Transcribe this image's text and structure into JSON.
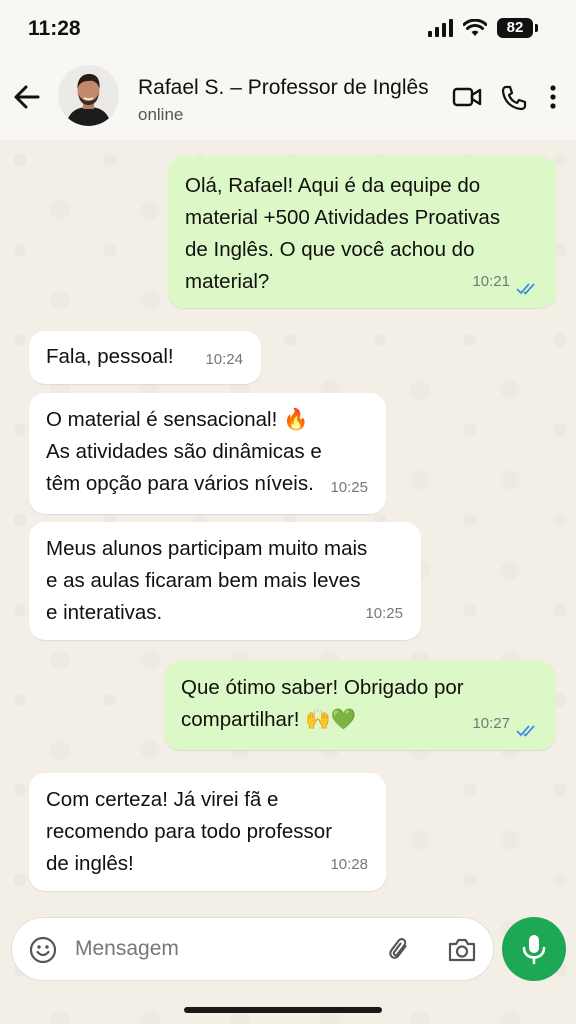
{
  "status_bar": {
    "time": "11:28",
    "battery": "82"
  },
  "header": {
    "contact_name": "Rafael S. – Professor de Inglês",
    "contact_status": "online"
  },
  "messages": [
    {
      "direction": "out",
      "text": "Olá, Rafael! Aqui é da equipe do\nmaterial +500 Atividades Proativas\nde Inglês. O que você achou do\nmaterial?",
      "time": "10:21",
      "read": true
    },
    {
      "direction": "in",
      "text": "Fala, pessoal!",
      "time": "10:24"
    },
    {
      "direction": "in",
      "text": "O material é sensacional! 🔥\nAs atividades são dinâmicas e\ntêm opção para vários níveis.",
      "time": "10:25"
    },
    {
      "direction": "in",
      "text": "Meus alunos participam muito mais\ne as aulas ficaram bem mais leves\ne interativas.",
      "time": "10:25"
    },
    {
      "direction": "out",
      "text": "Que ótimo saber! Obrigado por\ncompartilhar! 🙌💚",
      "time": "10:27",
      "read": true
    },
    {
      "direction": "in",
      "text": "Com certeza! Já virei fã e\nrecomendo para todo professor\nde inglês!",
      "time": "10:28"
    }
  ],
  "composer": {
    "placeholder": "Mensagem"
  },
  "colors": {
    "outgoing_bubble": "#dcf8c6",
    "incoming_bubble": "#ffffff",
    "read_ticks": "#3b8fe0",
    "mic_button": "#1da855"
  },
  "icons": [
    "back-arrow-icon",
    "video-call-icon",
    "phone-icon",
    "more-options-icon",
    "emoji-icon",
    "attach-icon",
    "camera-icon",
    "mic-icon"
  ]
}
